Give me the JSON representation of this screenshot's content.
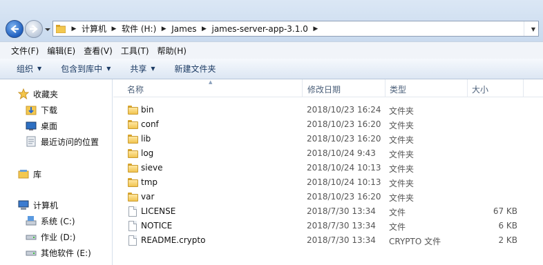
{
  "address": {
    "crumbs": [
      "计算机",
      "软件 (H:)",
      "James",
      "james-server-app-3.1.0"
    ]
  },
  "menu": [
    "文件(F)",
    "编辑(E)",
    "查看(V)",
    "工具(T)",
    "帮助(H)"
  ],
  "toolbar": {
    "organize": "组织",
    "include_library": "包含到库中",
    "share": "共享",
    "new_folder": "新建文件夹"
  },
  "nav": {
    "favorites": "收藏夹",
    "downloads": "下载",
    "desktop": "桌面",
    "recent": "最近访问的位置",
    "libraries": "库",
    "computer": "计算机",
    "drive_c": "系统 (C:)",
    "drive_d": "作业 (D:)",
    "drive_e": "其他软件 (E:)"
  },
  "columns": {
    "name": "名称",
    "modified": "修改日期",
    "type": "类型",
    "size": "大小"
  },
  "files": [
    {
      "name": "bin",
      "date": "2018/10/23 16:24",
      "type": "文件夹",
      "size": "",
      "kind": "folder"
    },
    {
      "name": "conf",
      "date": "2018/10/23 16:20",
      "type": "文件夹",
      "size": "",
      "kind": "folder"
    },
    {
      "name": "lib",
      "date": "2018/10/23 16:20",
      "type": "文件夹",
      "size": "",
      "kind": "folder"
    },
    {
      "name": "log",
      "date": "2018/10/24 9:43",
      "type": "文件夹",
      "size": "",
      "kind": "folder"
    },
    {
      "name": "sieve",
      "date": "2018/10/24 10:13",
      "type": "文件夹",
      "size": "",
      "kind": "folder"
    },
    {
      "name": "tmp",
      "date": "2018/10/24 10:13",
      "type": "文件夹",
      "size": "",
      "kind": "folder"
    },
    {
      "name": "var",
      "date": "2018/10/23 16:20",
      "type": "文件夹",
      "size": "",
      "kind": "folder"
    },
    {
      "name": "LICENSE",
      "date": "2018/7/30 13:34",
      "type": "文件",
      "size": "67 KB",
      "kind": "file"
    },
    {
      "name": "NOTICE",
      "date": "2018/7/30 13:34",
      "type": "文件",
      "size": "6 KB",
      "kind": "file"
    },
    {
      "name": "README.crypto",
      "date": "2018/7/30 13:34",
      "type": "CRYPTO 文件",
      "size": "2 KB",
      "kind": "file"
    }
  ]
}
